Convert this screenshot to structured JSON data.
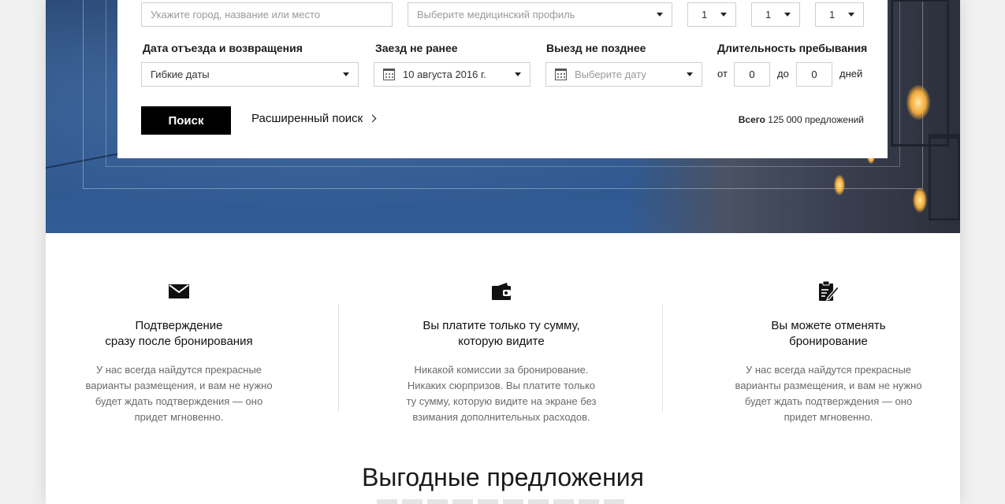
{
  "search": {
    "location_placeholder": "Укажите город, название или место",
    "profile_placeholder": "Выберите медицинский профиль",
    "guests": [
      "1",
      "1",
      "1"
    ],
    "labels": {
      "dates": "Дата отъезда и возвращения",
      "checkin": "Заезд не ранее",
      "checkout": "Выезд не позднее",
      "duration": "Длительность пребывания"
    },
    "dates_value": "Гибкие даты",
    "checkin_value": "10 августа 2016 г.",
    "checkout_placeholder": "Выберите дату",
    "duration": {
      "from_label": "от",
      "from_value": "0",
      "to_label": "до",
      "to_value": "0",
      "unit": "дней"
    },
    "search_button": "Поиск",
    "advanced_link": "Расширенный поиск",
    "total": {
      "prefix": "Всего",
      "count": "125 000 предложений"
    }
  },
  "features": [
    {
      "icon": "envelope-icon",
      "title_line1": "Подтверждение",
      "title_line2": "сразу после бронирования",
      "description": "У нас всегда найдутся прекрасные варианты размещения, и вам не нужно будет ждать подтверждения — оно придет мгновенно."
    },
    {
      "icon": "wallet-icon",
      "title_line1": "Вы платите только ту сумму,",
      "title_line2": "которую видите",
      "description": "Никакой комиссии за бронирование. Никаких сюрпризов. Вы платите только ту сумму, которую видите на экране без взимания дополнительных расходов."
    },
    {
      "icon": "clipboard-edit-icon",
      "title_line1": "Вы можете отменять",
      "title_line2": "бронирование",
      "description": "У нас всегда найдутся прекрасные варианты размещения, и вам не нужно будет ждать подтверждения — оно придет мгновенно."
    }
  ],
  "offers": {
    "title": "Выгодные предложения"
  },
  "colors": {
    "hero_blue": "#2b5288",
    "button_bg": "#000000",
    "text_muted": "#6a6a6a"
  }
}
